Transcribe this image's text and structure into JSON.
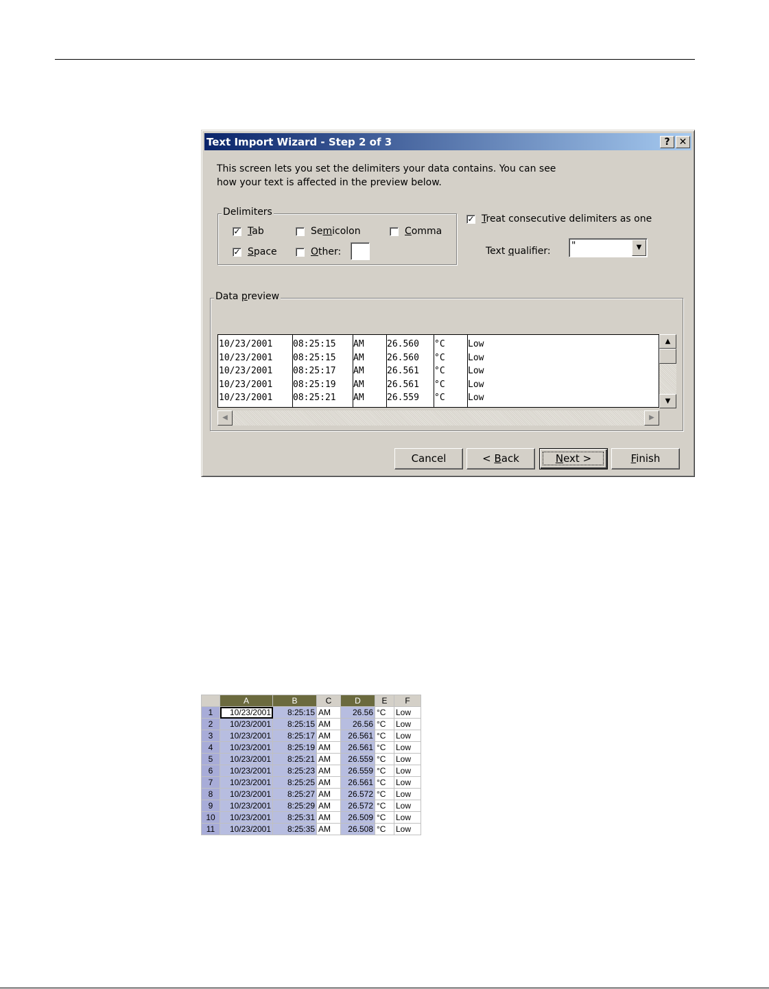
{
  "dialog": {
    "title": "Text Import Wizard - Step 2 of 3",
    "help_button": "?",
    "close_button": "✕",
    "intro_line1": "This screen lets you set the delimiters your data contains.  You can see",
    "intro_line2": "how your text is affected in the preview below.",
    "delimiters": {
      "label": "Delimiters",
      "tab": {
        "pre": "",
        "key": "T",
        "post": "ab",
        "checked": true
      },
      "semicolon": {
        "pre": "Se",
        "key": "m",
        "post": "icolon",
        "checked": false
      },
      "comma": {
        "pre": "",
        "key": "C",
        "post": "omma",
        "checked": false
      },
      "space": {
        "pre": "",
        "key": "S",
        "post": "pace",
        "checked": true
      },
      "other": {
        "pre": "",
        "key": "O",
        "post": "ther:",
        "checked": false,
        "value": ""
      }
    },
    "consecutive": {
      "pre": "",
      "key": "T",
      "post": "reat consecutive delimiters as one",
      "checked": true
    },
    "text_qualifier": {
      "pre": "Text ",
      "key": "q",
      "post": "ualifier:",
      "value": "\""
    },
    "data_preview": {
      "label_pre": "Data ",
      "label_key": "p",
      "label_post": "review",
      "rows": [
        [
          "10/23/2001",
          "08:25:15",
          "AM",
          "26.560",
          "°C",
          "Low"
        ],
        [
          "10/23/2001",
          "08:25:15",
          "AM",
          "26.560",
          "°C",
          "Low"
        ],
        [
          "10/23/2001",
          "08:25:17",
          "AM",
          "26.561",
          "°C",
          "Low"
        ],
        [
          "10/23/2001",
          "08:25:19",
          "AM",
          "26.561",
          "°C",
          "Low"
        ],
        [
          "10/23/2001",
          "08:25:21",
          "AM",
          "26.559",
          "°C",
          "Low"
        ]
      ]
    },
    "buttons": {
      "cancel": "Cancel",
      "back_pre": "< ",
      "back_key": "B",
      "back_post": "ack",
      "next_pre": "",
      "next_key": "N",
      "next_post": "ext >",
      "finish_pre": "",
      "finish_key": "F",
      "finish_post": "inish"
    }
  },
  "spreadsheet": {
    "columns": [
      "A",
      "B",
      "C",
      "D",
      "E",
      "F"
    ],
    "selected_columns": [
      "A",
      "B",
      "D"
    ],
    "rows": [
      {
        "n": "1",
        "a": "10/23/2001",
        "b": "8:25:15",
        "c": "AM",
        "d": "26.56",
        "e": "°C",
        "f": "Low"
      },
      {
        "n": "2",
        "a": "10/23/2001",
        "b": "8:25:15",
        "c": "AM",
        "d": "26.56",
        "e": "°C",
        "f": "Low"
      },
      {
        "n": "3",
        "a": "10/23/2001",
        "b": "8:25:17",
        "c": "AM",
        "d": "26.561",
        "e": "°C",
        "f": "Low"
      },
      {
        "n": "4",
        "a": "10/23/2001",
        "b": "8:25:19",
        "c": "AM",
        "d": "26.561",
        "e": "°C",
        "f": "Low"
      },
      {
        "n": "5",
        "a": "10/23/2001",
        "b": "8:25:21",
        "c": "AM",
        "d": "26.559",
        "e": "°C",
        "f": "Low"
      },
      {
        "n": "6",
        "a": "10/23/2001",
        "b": "8:25:23",
        "c": "AM",
        "d": "26.559",
        "e": "°C",
        "f": "Low"
      },
      {
        "n": "7",
        "a": "10/23/2001",
        "b": "8:25:25",
        "c": "AM",
        "d": "26.561",
        "e": "°C",
        "f": "Low"
      },
      {
        "n": "8",
        "a": "10/23/2001",
        "b": "8:25:27",
        "c": "AM",
        "d": "26.572",
        "e": "°C",
        "f": "Low"
      },
      {
        "n": "9",
        "a": "10/23/2001",
        "b": "8:25:29",
        "c": "AM",
        "d": "26.572",
        "e": "°C",
        "f": "Low"
      },
      {
        "n": "10",
        "a": "10/23/2001",
        "b": "8:25:31",
        "c": "AM",
        "d": "26.509",
        "e": "°C",
        "f": "Low"
      },
      {
        "n": "11",
        "a": "10/23/2001",
        "b": "8:25:35",
        "c": "AM",
        "d": "26.508",
        "e": "°C",
        "f": "Low"
      }
    ]
  }
}
